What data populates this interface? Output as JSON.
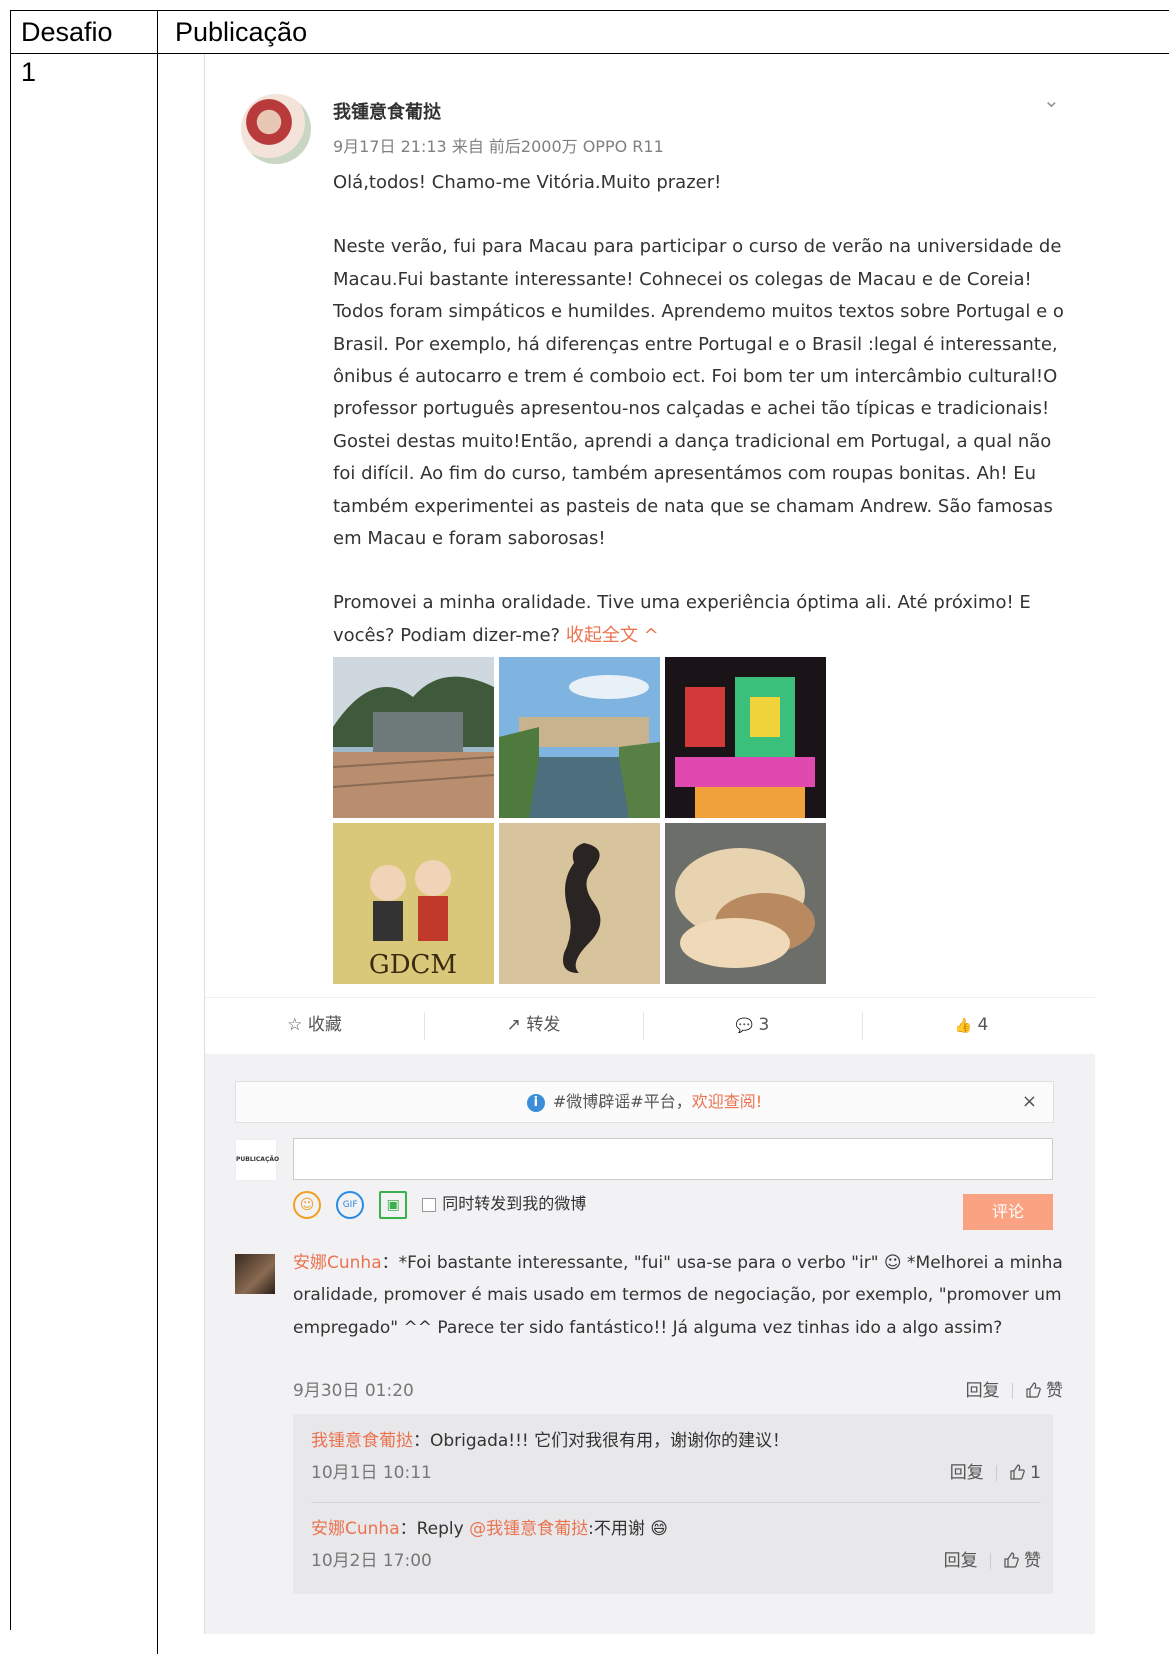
{
  "table": {
    "col1_header": "Desafio",
    "col2_header": "Publicação",
    "row1_label": "1"
  },
  "post": {
    "username": "我锺意食葡挞",
    "meta": "9月17日 21:13 来自 前后2000万 OPPO R11",
    "greeting": "Olá,todos! Chamo-me Vitória.Muito prazer!",
    "body": "Neste verão, fui para Macau para participar o curso de verão na universidade de Macau.Fui bastante interessante! Cohnecei os colegas de Macau e de Coreia! Todos foram simpáticos e humildes. Aprendemo muitos textos sobre Portugal e o Brasil. Por exemplo, há diferenças entre Portugal e o Brasil :legal é interessante, ônibus é autocarro e trem é comboio ect. Foi bom ter um intercâmbio cultural!O professor português apresentou-nos calçadas e achei tão típicas e tradicionais! Gostei destas muito!Então, aprendi a dança tradicional em Portugal, a qual não foi difícil. Ao fim do curso, também apresentámos com roupas bonitas. Ah! Eu também experimentei as pasteis de nata que se chamam Andrew. São famosas em Macau e foram saborosas!",
    "closing": "Promovei a minha oralidade. Tive uma experiência óptima ali. Até próximo! E vocês? Podiam dizer-me?",
    "collapse_label": "收起全文",
    "collapse_icon": "^",
    "chevron_icon": "⌄"
  },
  "actions": {
    "favorite_icon": "☆",
    "favorite_label": "收藏",
    "repost_icon": "↗",
    "repost_label": "转发",
    "comment_icon": "💬",
    "comment_count": "3",
    "like_icon": "👍",
    "like_count": "4"
  },
  "comment_box": {
    "notice_prefix": "#微博辟谣#平台，",
    "notice_link": "欢迎查阅!",
    "notice_close": "×",
    "sync_label": "同时转发到我的微博",
    "submit_label": "评论",
    "my_avatar_text": "PUBLICAÇÃO"
  },
  "comments": [
    {
      "author": "安娜Cunha",
      "text": "：*Foi bastante interessante, \"fui\" usa-se para o verbo \"ir\" ☺ *Melhorei a minha oralidade, promover é mais usado em termos de negociação, por exemplo, \"promover um empregado\" ^^ Parece ter sido fantástico!! Já alguma vez tinhas ido a algo assim?",
      "time": "9月30日 01:20",
      "reply_label": "回复",
      "like_label": "赞"
    }
  ],
  "replies": [
    {
      "author": "我锺意食葡挞",
      "text": "：Obrigada!!! 它们对我很有用，谢谢你的建议！",
      "time": "10月1日 10:11",
      "reply_label": "回复",
      "like_label": "1"
    },
    {
      "author": "安娜Cunha",
      "text_prefix": "：Reply ",
      "mention": "@我锺意食葡挞",
      "text_suffix": ":不用谢 😄",
      "time": "10月2日 17:00",
      "reply_label": "回复",
      "like_label": "赞"
    }
  ],
  "photos": [
    {
      "icon": "park-sign-photo"
    },
    {
      "icon": "river-campus-photo"
    },
    {
      "icon": "casino-lights-photo"
    },
    {
      "icon": "poster-gdcm-photo"
    },
    {
      "icon": "seahorse-pavement-photo"
    },
    {
      "icon": "pork-bun-photo"
    }
  ],
  "poster_text": "GDCM"
}
